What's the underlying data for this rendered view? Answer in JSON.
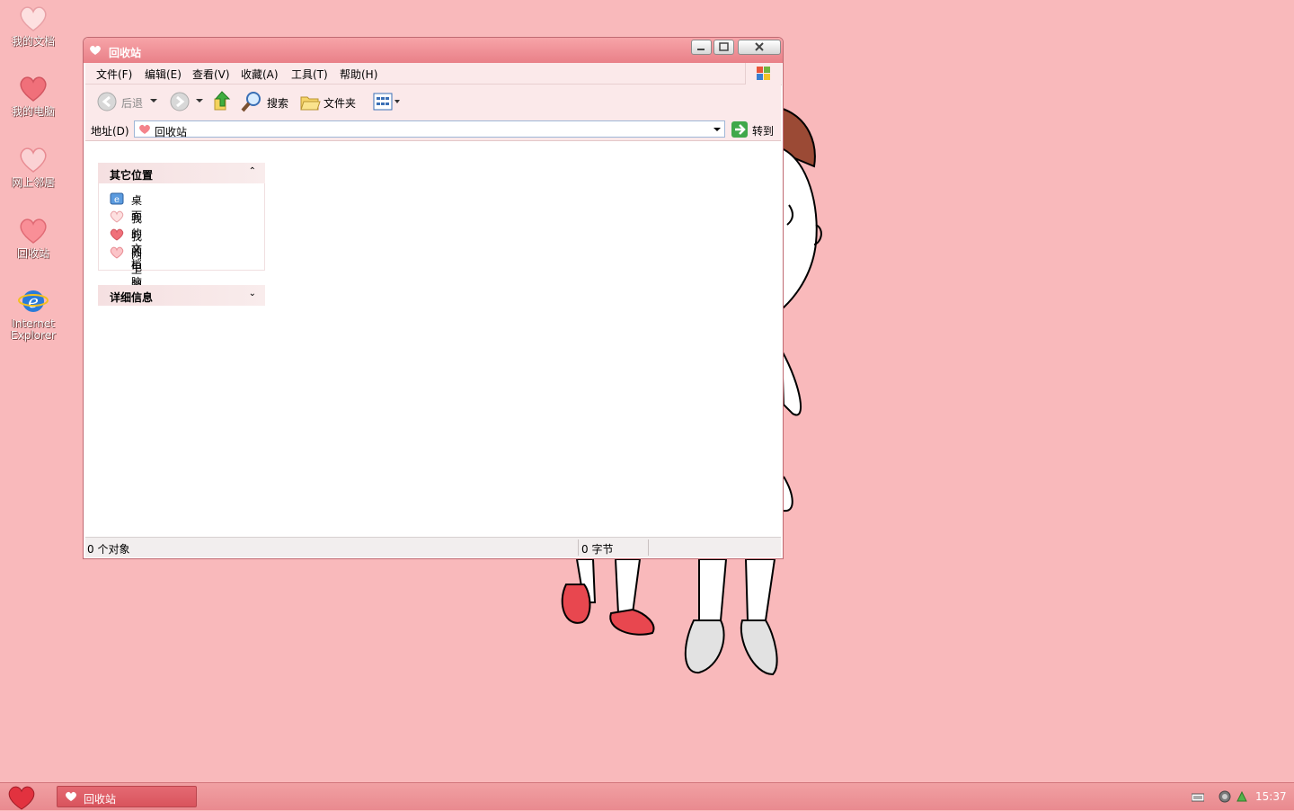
{
  "desktop": {
    "icons": [
      {
        "label": "我的文档"
      },
      {
        "label": "我的电脑"
      },
      {
        "label": "网上邻居"
      },
      {
        "label": "回收站"
      },
      {
        "label": "Internet Explorer"
      }
    ]
  },
  "window": {
    "title": "回收站",
    "menu": [
      "文件(F)",
      "编辑(E)",
      "查看(V)",
      "收藏(A)",
      "工具(T)",
      "帮助(H)"
    ],
    "toolbar": {
      "back_label": "后退",
      "search_label": "搜索",
      "folders_label": "文件夹"
    },
    "address": {
      "label": "地址(D)",
      "value": "回收站",
      "go_label": "转到"
    },
    "panels": {
      "other_places": {
        "title": "其它位置",
        "items": [
          "桌面",
          "我的文档",
          "我的电脑",
          "网上邻居"
        ]
      },
      "details": {
        "title": "详细信息"
      }
    },
    "status": {
      "objects": "0 个对象",
      "size": "0 字节"
    }
  },
  "taskbar": {
    "task_title": "回收站",
    "clock": "15:37"
  },
  "colors": {
    "desktop_bg": "#f9b9bb",
    "title_bar": "#e98088",
    "taskbar": "#e98a8f"
  }
}
